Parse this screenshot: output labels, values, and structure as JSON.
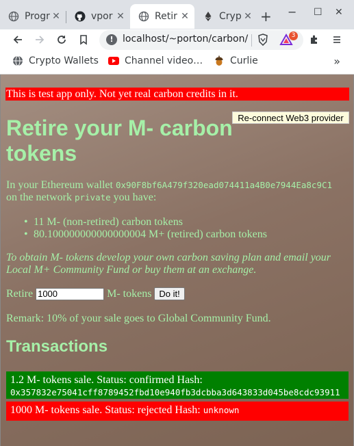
{
  "browser": {
    "tabs": [
      {
        "title": "Progr",
        "icon": "globe-icon"
      },
      {
        "title": "vpor",
        "icon": "github-icon"
      },
      {
        "title": "Retir",
        "icon": "globe-icon",
        "active": true
      },
      {
        "title": "Cryp",
        "icon": "ethereum-icon"
      }
    ],
    "url": "localhost/~porton/carbon/",
    "brave_badge": "3",
    "bookmarks": [
      {
        "label": "Crypto Wallets",
        "icon": "globe-icon"
      },
      {
        "label": "Channel video…",
        "icon": "youtube-icon"
      },
      {
        "label": "Curlie",
        "icon": "acorn-icon"
      }
    ]
  },
  "page": {
    "warning": "This is test app only. Not yet real carbon credits in it.",
    "reconnect_label": "Re-connect Web3 provider",
    "heading": "Retire your M- carbon tokens",
    "wallet_prefix": "In your Ethereum wallet",
    "wallet_address": "0x90F8bf6A479f320ead074411a4B0e7944Ea8c9C1",
    "network_prefix": "on the network",
    "network_name": "private",
    "network_suffix": "you have:",
    "holdings": [
      "11 M- (non-retired) carbon tokens",
      "80.100000000000000004 M+ (retired) carbon tokens"
    ],
    "obtain_text": "To obtain M- tokens develop your own carbon saving plan and email your Local M+ Community Fund or buy them at an exchange.",
    "retire_label": "Retire",
    "retire_value": "1000",
    "retire_unit": "M- tokens",
    "doit_label": "Do it!",
    "remark": "Remark: 10% of your sale goes to Global Community Fund.",
    "transactions_heading": "Transactions",
    "transactions": [
      {
        "text": "1.2 M- tokens sale. Status: confirmed Hash:",
        "hash": "0x357832e75041cff8789452fbd10e940fb3dcbba3d643833d045be8cdc93911",
        "status": "confirmed"
      },
      {
        "text": "1000 M- tokens sale. Status: rejected Hash:",
        "hash": "unknown",
        "status": "rejected"
      }
    ]
  },
  "colors": {
    "warning_bg": "#ff0000",
    "confirmed_bg": "#008000",
    "rejected_bg": "#ff0000",
    "text_green": "#a6f0a8"
  }
}
